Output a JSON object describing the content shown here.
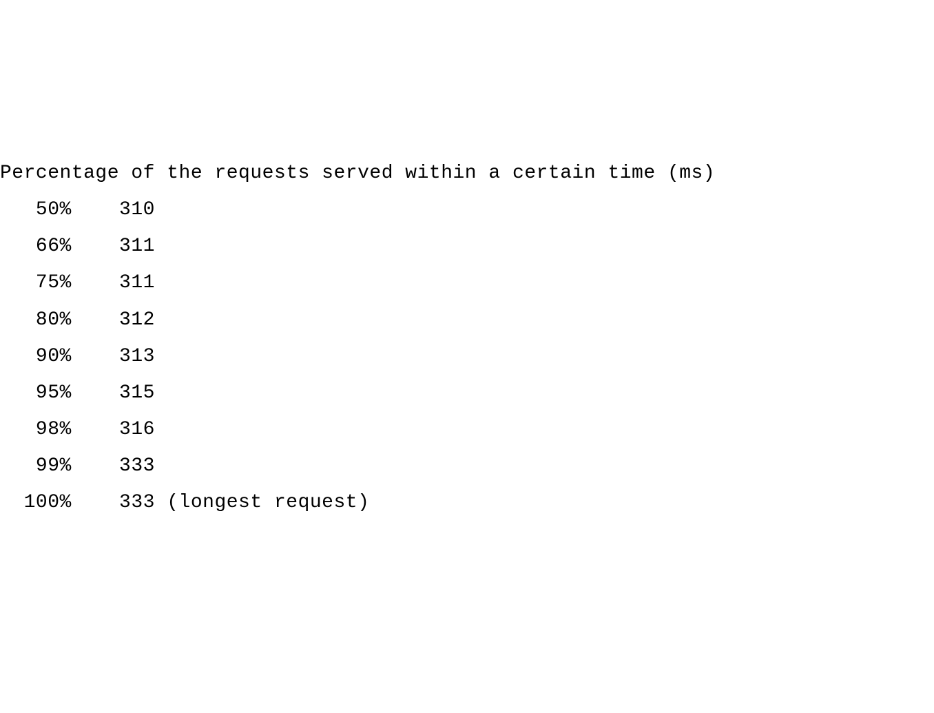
{
  "header": "Percentage of the requests served within a certain time (ms)",
  "rows": [
    {
      "pct": "50%",
      "ms": "310",
      "note": ""
    },
    {
      "pct": "66%",
      "ms": "311",
      "note": ""
    },
    {
      "pct": "75%",
      "ms": "311",
      "note": ""
    },
    {
      "pct": "80%",
      "ms": "312",
      "note": ""
    },
    {
      "pct": "90%",
      "ms": "313",
      "note": ""
    },
    {
      "pct": "95%",
      "ms": "315",
      "note": ""
    },
    {
      "pct": "98%",
      "ms": "316",
      "note": ""
    },
    {
      "pct": "99%",
      "ms": "333",
      "note": ""
    },
    {
      "pct": "100%",
      "ms": "333",
      "note": "(longest request)"
    }
  ]
}
